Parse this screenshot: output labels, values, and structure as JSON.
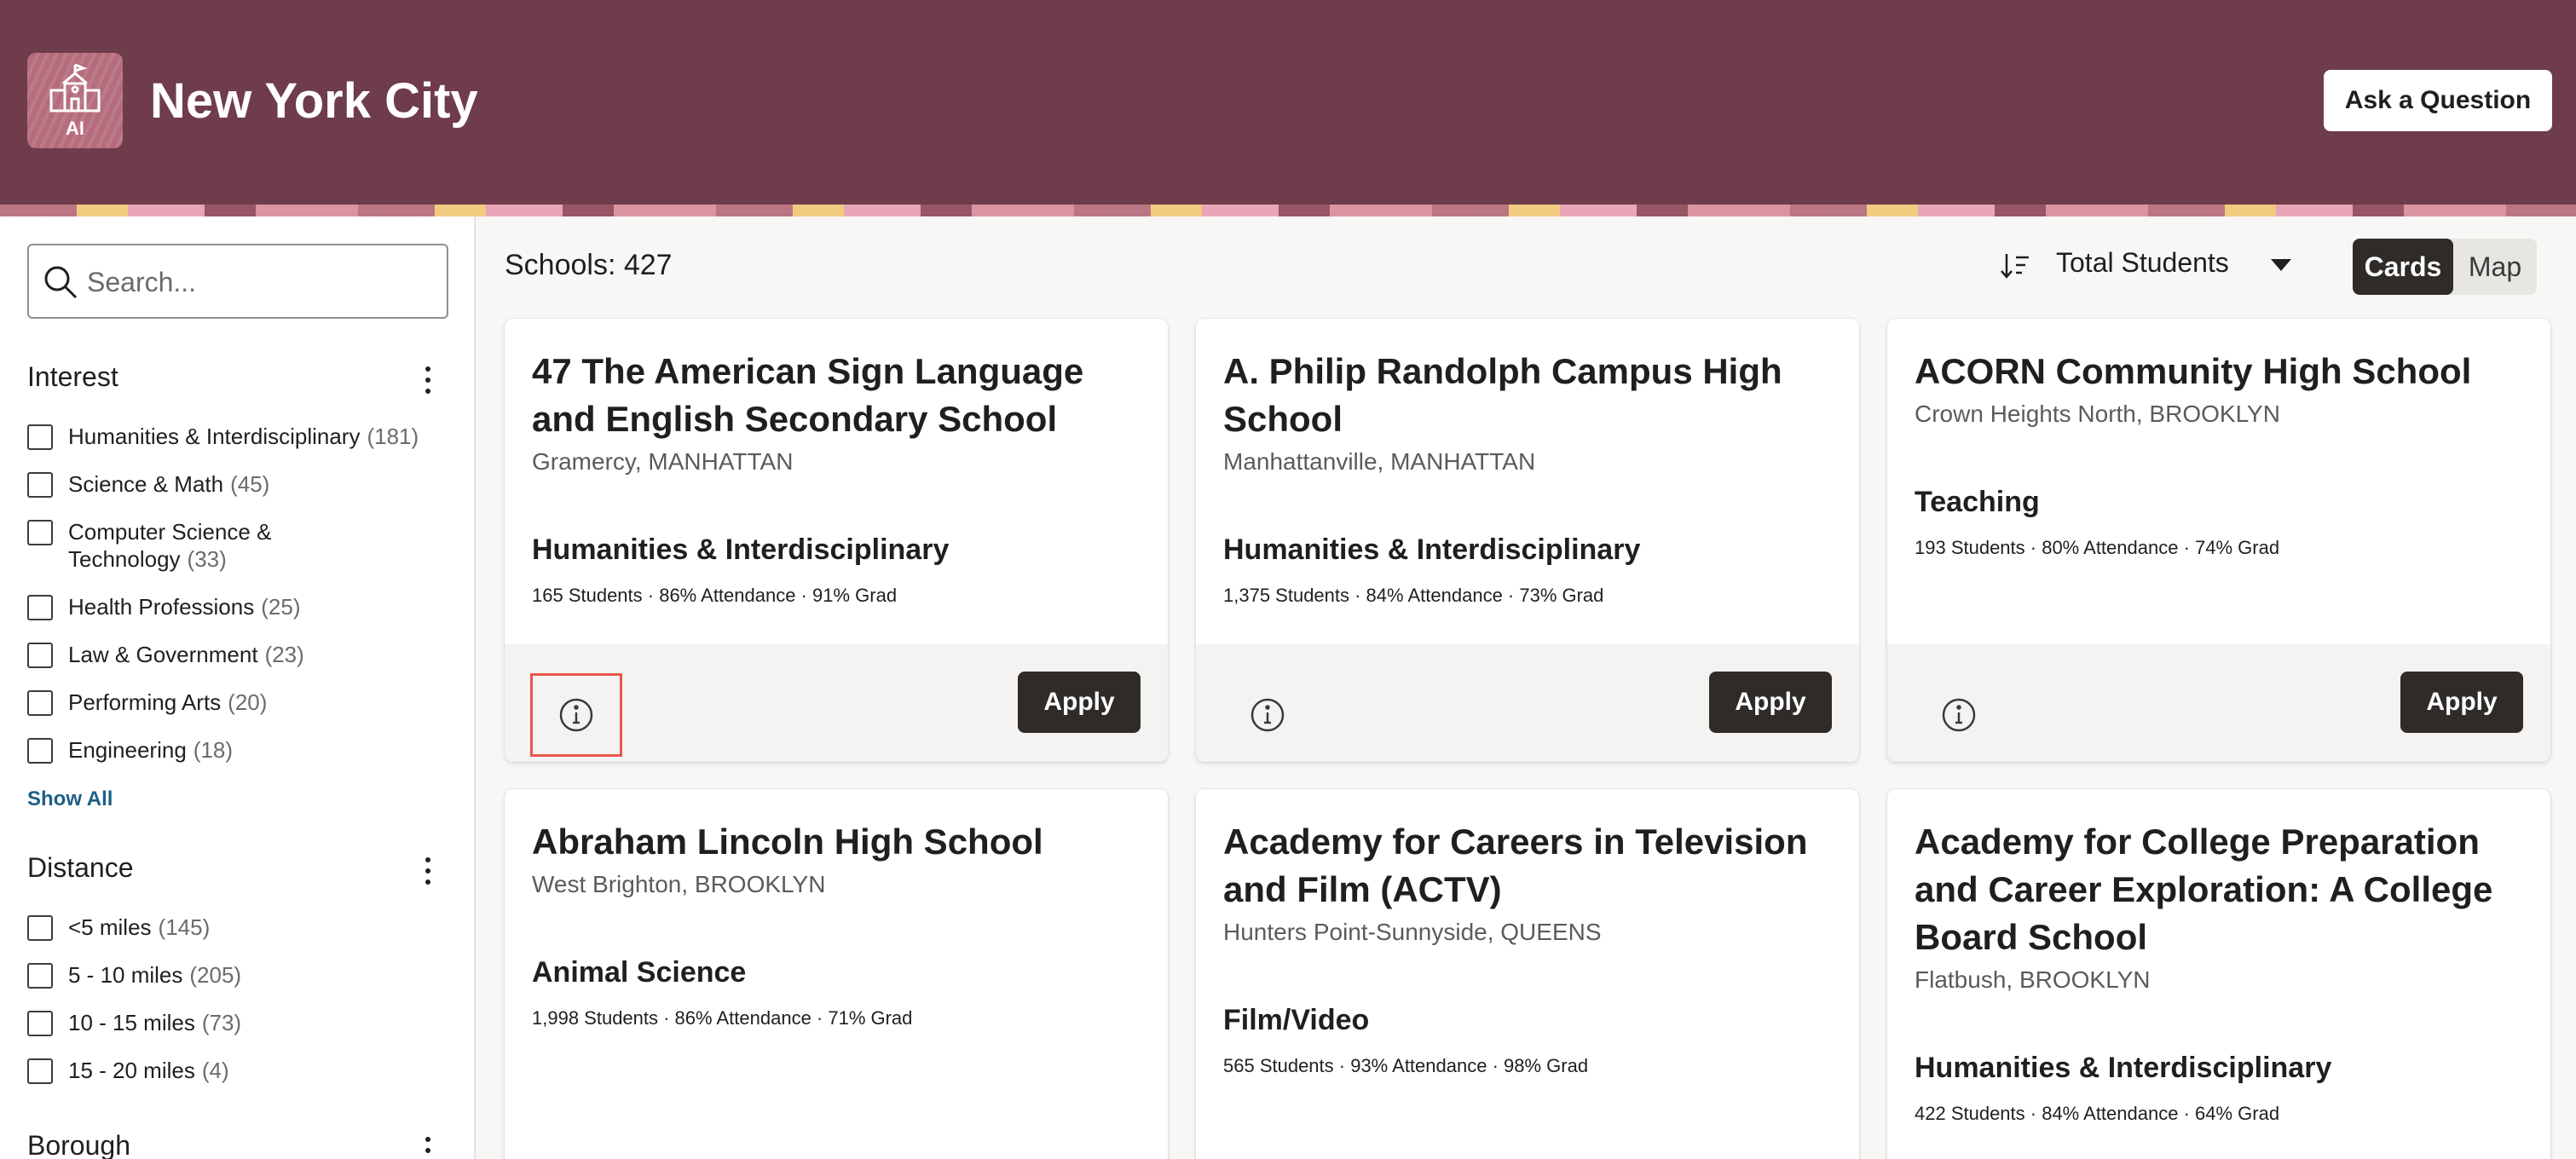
{
  "header": {
    "logo_text": "AI",
    "title": "New York City",
    "ask_button": "Ask a Question"
  },
  "sidebar": {
    "search_placeholder": "Search...",
    "groups": [
      {
        "title": "Interest",
        "items": [
          {
            "label": "Humanities & Interdisciplinary",
            "count": "(181)"
          },
          {
            "label": "Science & Math",
            "count": "(45)"
          },
          {
            "label": "Computer Science & Technology",
            "count": "(33)"
          },
          {
            "label": "Health Professions",
            "count": "(25)"
          },
          {
            "label": "Law & Government",
            "count": "(23)"
          },
          {
            "label": "Performing Arts",
            "count": "(20)"
          },
          {
            "label": "Engineering",
            "count": "(18)"
          }
        ],
        "show_all": "Show All"
      },
      {
        "title": "Distance",
        "items": [
          {
            "label": "<5 miles",
            "count": "(145)"
          },
          {
            "label": "5 - 10 miles",
            "count": "(205)"
          },
          {
            "label": "10 - 15 miles",
            "count": "(73)"
          },
          {
            "label": "15 - 20 miles",
            "count": "(4)"
          }
        ]
      },
      {
        "title": "Borough"
      }
    ]
  },
  "main": {
    "count_label": "Schools: 427",
    "sort_value": "Total Students",
    "view_toggle": {
      "cards": "Cards",
      "map": "Map",
      "selected": "Cards"
    },
    "apply_label": "Apply",
    "schools": [
      {
        "name": "47 The American Sign Language and English Secondary School",
        "location": "Gramercy, MANHATTAN",
        "interest": "Humanities & Interdisciplinary",
        "stats": "165 Students · 86% Attendance · 91% Grad"
      },
      {
        "name": "A. Philip Randolph Campus High School",
        "location": "Manhattanville, MANHATTAN",
        "interest": "Humanities & Interdisciplinary",
        "stats": "1,375 Students · 84% Attendance · 73% Grad"
      },
      {
        "name": "ACORN Community High School",
        "location": "Crown Heights North, BROOKLYN",
        "interest": "Teaching",
        "stats": "193 Students · 80% Attendance · 74% Grad"
      },
      {
        "name": "Abraham Lincoln High School",
        "location": "West Brighton, BROOKLYN",
        "interest": "Animal Science",
        "stats": "1,998 Students · 86% Attendance · 71% Grad"
      },
      {
        "name": "Academy for Careers in Television and Film (ACTV)",
        "location": "Hunters Point-Sunnyside, QUEENS",
        "interest": "Film/Video",
        "stats": "565 Students · 93% Attendance · 98% Grad"
      },
      {
        "name": "Academy for College Preparation and Career Exploration: A College Board School",
        "location": "Flatbush, BROOKLYN",
        "interest": "Humanities & Interdisciplinary",
        "stats": "422 Students · 84% Attendance · 64% Grad"
      }
    ]
  },
  "colors": {
    "header_bg": "#6e3c4a",
    "primary_button": "#2e2b28",
    "link": "#1e5f86",
    "focus_ring": "#e8574a"
  },
  "icons": [
    "school-building-icon",
    "search-icon",
    "kebab-menu-icon",
    "sort-icon",
    "chevron-down-icon",
    "info-icon"
  ]
}
